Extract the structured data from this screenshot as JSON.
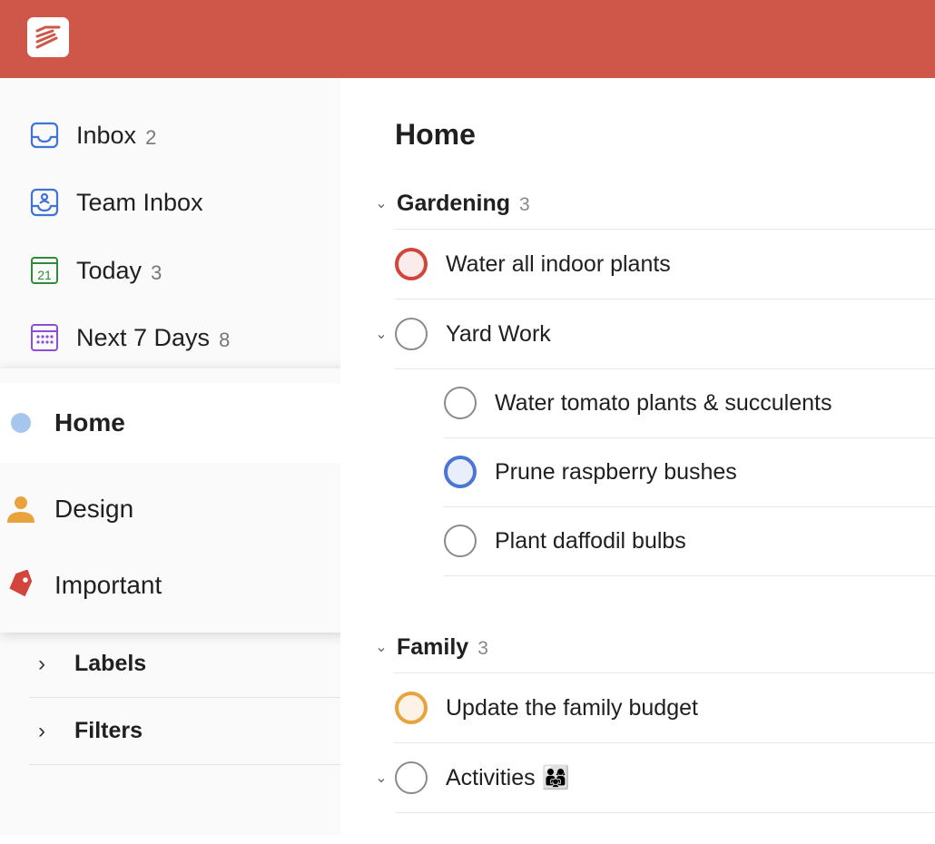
{
  "sidebar": {
    "nav": [
      {
        "label": "Inbox",
        "count": "2",
        "icon": "inbox-icon",
        "color": "#4073d6"
      },
      {
        "label": "Team Inbox",
        "count": "",
        "icon": "team-inbox-icon",
        "color": "#4073d6"
      },
      {
        "label": "Today",
        "count": "3",
        "icon": "calendar-today-icon",
        "color": "#2f8a3a",
        "day": "21"
      },
      {
        "label": "Next 7 Days",
        "count": "8",
        "icon": "calendar-week-icon",
        "color": "#8a4fd6"
      }
    ],
    "popup": [
      {
        "label": "Home",
        "icon": "dot-icon",
        "color": "#a6c6ed"
      },
      {
        "label": "Design",
        "icon": "person-icon",
        "color": "#e8a33d"
      },
      {
        "label": "Important",
        "icon": "tag-icon",
        "color": "#d1453b"
      }
    ],
    "sections": [
      {
        "label": "Labels"
      },
      {
        "label": "Filters"
      }
    ]
  },
  "main": {
    "title": "Home",
    "sections": [
      {
        "name": "Gardening",
        "count": "3",
        "tasks": [
          {
            "label": "Water all indoor plants"
          },
          {
            "label": "Yard Work"
          },
          {
            "label": "Water tomato plants & succulents"
          },
          {
            "label": "Prune raspberry bushes"
          },
          {
            "label": "Plant daffodil bulbs"
          }
        ]
      },
      {
        "name": "Family",
        "count": "3",
        "tasks": [
          {
            "label": "Update the family budget"
          },
          {
            "label": "Activities 👨‍👩‍👧"
          }
        ]
      }
    ]
  },
  "colors": {
    "brand": "#cf5749",
    "priority1": "#d1453b",
    "priority2": "#4b76d4",
    "priority3": "#e8a33d"
  }
}
